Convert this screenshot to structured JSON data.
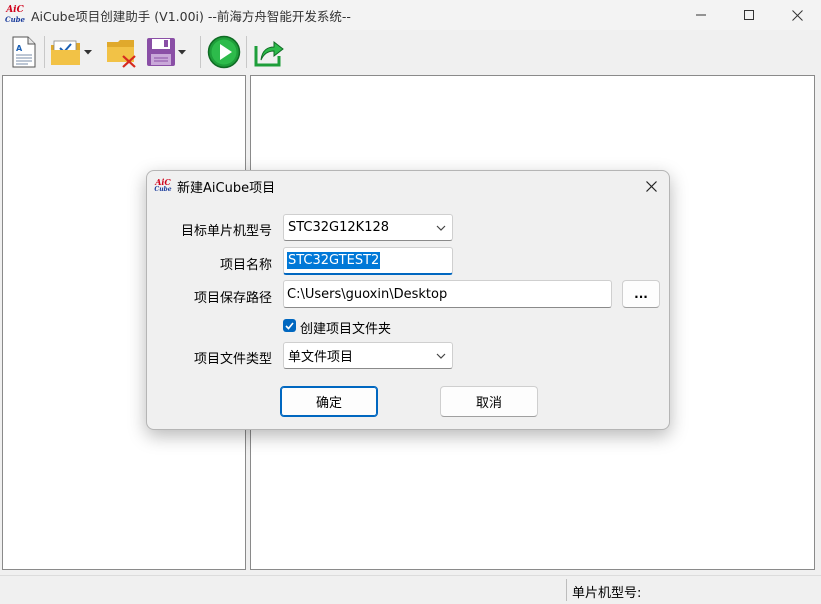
{
  "window": {
    "title": "AiCube项目创建助手 (V1.00i) --前海方舟智能开发系统--",
    "logo_top": "AiC",
    "logo_bottom": "Cube"
  },
  "toolbar": {
    "items": [
      {
        "name": "new-project",
        "icon": "document-icon"
      },
      {
        "name": "open-project",
        "icon": "folder-check-icon",
        "dropdown": true
      },
      {
        "name": "close-project",
        "icon": "folder-delete-icon"
      },
      {
        "name": "save-project",
        "icon": "floppy-disk-icon",
        "dropdown": true
      },
      {
        "name": "run",
        "icon": "play-icon"
      },
      {
        "name": "export",
        "icon": "share-icon"
      }
    ]
  },
  "statusbar": {
    "mcu_label": "单片机型号:"
  },
  "dialog": {
    "title": "新建AiCube项目",
    "logo_top": "AiC",
    "logo_bottom": "Cube",
    "mcu_label": "目标单片机型号",
    "mcu_value": "STC32G12K128",
    "name_label": "项目名称",
    "name_value": "STC32GTEST2",
    "path_label": "项目保存路径",
    "path_value": "C:\\Users\\guoxin\\Desktop",
    "browse_label": "...",
    "create_folder_label": "创建项目文件夹",
    "create_folder_checked": true,
    "type_label": "项目文件类型",
    "type_value": "单文件项目",
    "ok_label": "确定",
    "cancel_label": "取消"
  },
  "colors": {
    "accent": "#0067c0",
    "selection": "#0078d7",
    "play_green": "#1e9e3a",
    "folder_yellow": "#f2c246",
    "floppy_purple": "#8a4fa6",
    "delete_red": "#d62a1e"
  }
}
